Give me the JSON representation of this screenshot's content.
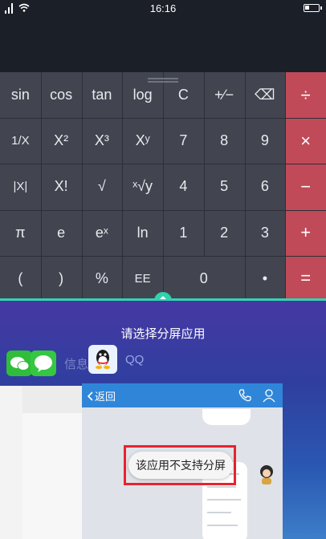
{
  "status_bar": {
    "time": "16:16",
    "battery_level": 0.35
  },
  "calculator": {
    "rows": [
      [
        {
          "label": "sin",
          "name": "sin"
        },
        {
          "label": "cos",
          "name": "cos"
        },
        {
          "label": "tan",
          "name": "tan"
        },
        {
          "label": "log",
          "name": "log"
        },
        {
          "label": "C",
          "name": "clear"
        },
        {
          "label": "+∕−",
          "name": "plus-minus"
        },
        {
          "label": "⌫",
          "name": "backspace"
        },
        {
          "label": "÷",
          "name": "divide",
          "op": true
        }
      ],
      [
        {
          "label": "1/X",
          "name": "reciprocal"
        },
        {
          "label": "X²",
          "name": "square"
        },
        {
          "label": "X³",
          "name": "cube"
        },
        {
          "label": "Xʸ",
          "name": "power"
        },
        {
          "label": "7",
          "name": "digit-7"
        },
        {
          "label": "8",
          "name": "digit-8"
        },
        {
          "label": "9",
          "name": "digit-9"
        },
        {
          "label": "×",
          "name": "multiply",
          "op": true
        }
      ],
      [
        {
          "label": "|X|",
          "name": "absolute"
        },
        {
          "label": "X!",
          "name": "factorial"
        },
        {
          "label": "√",
          "name": "square-root"
        },
        {
          "label": "ˣ√y",
          "name": "nth-root"
        },
        {
          "label": "4",
          "name": "digit-4"
        },
        {
          "label": "5",
          "name": "digit-5"
        },
        {
          "label": "6",
          "name": "digit-6"
        },
        {
          "label": "−",
          "name": "subtract",
          "op": true
        }
      ],
      [
        {
          "label": "π",
          "name": "pi"
        },
        {
          "label": "e",
          "name": "euler"
        },
        {
          "label": "eˣ",
          "name": "exp"
        },
        {
          "label": "ln",
          "name": "ln"
        },
        {
          "label": "1",
          "name": "digit-1"
        },
        {
          "label": "2",
          "name": "digit-2"
        },
        {
          "label": "3",
          "name": "digit-3"
        },
        {
          "label": "+",
          "name": "add",
          "op": true
        }
      ],
      [
        {
          "label": "(",
          "name": "open-paren"
        },
        {
          "label": ")",
          "name": "close-paren"
        },
        {
          "label": "%",
          "name": "percent"
        },
        {
          "label": "EE",
          "name": "exponent-ee"
        },
        {
          "label": "0",
          "name": "digit-0",
          "wide": true
        },
        {
          "label": "•",
          "name": "decimal-point"
        },
        {
          "label": "=",
          "name": "equals",
          "op": true
        }
      ]
    ],
    "colors": {
      "key_bg": "#42454f",
      "op_bg": "#c04a58"
    }
  },
  "split_screen": {
    "prompt": "请选择分屏应用",
    "apps": [
      {
        "label": "信息",
        "icon": "wechat-icon"
      },
      {
        "label": "QQ",
        "icon": "qq-icon"
      }
    ],
    "recent_card": {
      "back_label": "返回"
    },
    "toast": "该应用不支持分屏",
    "divider_color": "#30d6b2"
  }
}
